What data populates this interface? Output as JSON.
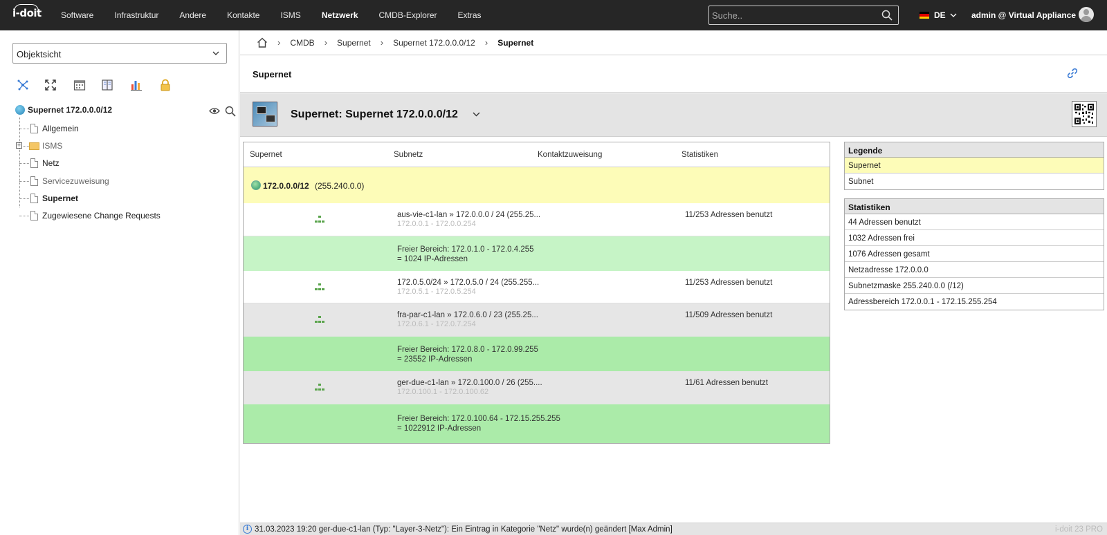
{
  "brand": {
    "logo_text": "i-doit"
  },
  "nav": {
    "items": [
      "Software",
      "Infrastruktur",
      "Andere",
      "Kontakte",
      "ISMS",
      "Netzwerk",
      "CMDB-Explorer",
      "Extras"
    ],
    "active": "Netzwerk"
  },
  "search": {
    "placeholder": "Suche.."
  },
  "lang": {
    "code": "DE"
  },
  "user": {
    "label": "admin @ Virtual Appliance"
  },
  "sidebar": {
    "view_select": "Objektsicht",
    "tools": [
      "network-icon",
      "fullscreen-icon",
      "calendar-icon",
      "book-icon",
      "chart-icon",
      "lock-icon"
    ],
    "tree": {
      "root": "Supernet 172.0.0.0/12",
      "items": [
        {
          "label": "Allgemein"
        },
        {
          "label": "ISMS"
        },
        {
          "label": "Netz"
        },
        {
          "label": "Servicezuweisung"
        },
        {
          "label": "Supernet"
        },
        {
          "label": "Zugewiesene Change Requests"
        }
      ]
    }
  },
  "breadcrumb": [
    "CMDB",
    "Supernet",
    "Supernet 172.0.0.0/12",
    "Supernet"
  ],
  "page": {
    "title": "Supernet"
  },
  "object": {
    "title": "Supernet: Supernet 172.0.0.0/12"
  },
  "table": {
    "headers": [
      "Supernet",
      "Subnetz",
      "Kontaktzuweisung",
      "Statistiken"
    ],
    "supernet": {
      "address": "172.0.0.0/12",
      "mask": "(255.240.0.0)"
    },
    "rows": [
      {
        "name": "aus-vie-c1-lan » 172.0.0.0 / 24 (255.25...",
        "range": "172.0.0.1 - 172.0.0.254",
        "stat": "11/253 Adressen benutzt"
      },
      {
        "free_line1": "Freier Bereich: 172.0.1.0 - 172.0.4.255",
        "free_line2": "= 1024 IP-Adressen"
      },
      {
        "name": "172.0.5.0/24 » 172.0.5.0 / 24 (255.255...",
        "range": "172.0.5.1 - 172.0.5.254",
        "stat": "11/253 Adressen benutzt"
      },
      {
        "name": "fra-par-c1-lan » 172.0.6.0 / 23 (255.25...",
        "range": "172.0.6.1 - 172.0.7.254",
        "stat": "11/509 Adressen benutzt"
      },
      {
        "free_line1": "Freier Bereich: 172.0.8.0 - 172.0.99.255",
        "free_line2": "= 23552 IP-Adressen"
      },
      {
        "name": "ger-due-c1-lan » 172.0.100.0 / 26 (255....",
        "range": "172.0.100.1 - 172.0.100.62",
        "stat": "11/61 Adressen benutzt"
      },
      {
        "free_line1": "Freier Bereich: 172.0.100.64 - 172.15.255.255",
        "free_line2": "= 1022912 IP-Adressen"
      }
    ]
  },
  "legend": {
    "title": "Legende",
    "items": [
      "Supernet",
      "Subnet"
    ]
  },
  "stats": {
    "title": "Statistiken",
    "items": [
      "44 Adressen benutzt",
      "1032 Adressen frei",
      "1076 Adressen gesamt",
      "Netzadresse 172.0.0.0",
      "Subnetzmaske 255.240.0.0 (/12)",
      "Adressbereich 172.0.0.1 - 172.15.255.254"
    ]
  },
  "statusbar": {
    "message": "31.03.2023 19:20 ger-due-c1-lan (Typ: \"Layer-3-Netz\"): Ein Eintrag in Kategorie \"Netz\" wurde(n) geändert [Max Admin]",
    "version": "i-doit 23 PRO"
  },
  "colors": {
    "topbar": "#262626",
    "supernet_row": "#fdfcb8",
    "free_range": "#abeba9",
    "accent": "#3a7bd5"
  }
}
